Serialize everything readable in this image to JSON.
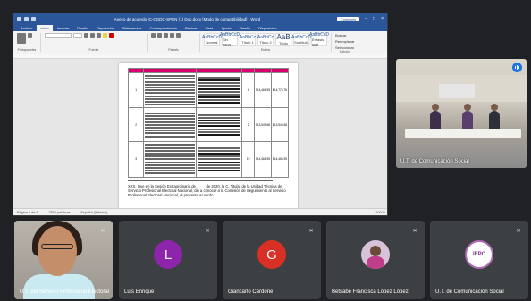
{
  "word": {
    "title": "Anexo de acuerdo IC-CGDC-SPEN (1) Doc.docx [Modo de compatibilidad] - Word",
    "share_label": "Compartir",
    "tabs": [
      "Archivo",
      "Inicio",
      "Insertar",
      "Diseño",
      "Disposición",
      "Referencias",
      "Correspondencia",
      "Revisar",
      "Vista",
      "Ayuda",
      "Diseño",
      "Disposición"
    ],
    "active_tab": "Inicio",
    "ribbon_groups": [
      "Portapapeles",
      "Fuente",
      "Párrafo",
      "Estilos",
      "Edición"
    ],
    "styles": [
      {
        "sample": "AaBbCcD",
        "name": "Normal"
      },
      {
        "sample": "AaBbCcD",
        "name": "Sin espa..."
      },
      {
        "sample": "AaBbCc",
        "name": "Título 1"
      },
      {
        "sample": "AaBbCc",
        "name": "Título 2"
      },
      {
        "sample": "AaB",
        "name": "Título"
      },
      {
        "sample": "AaBbCcD",
        "name": "Subtítulo"
      },
      {
        "sample": "AaBbCcD",
        "name": "Énfasis sutil"
      }
    ],
    "edit_items": [
      "Buscar",
      "Reemplazar",
      "Seleccionar"
    ],
    "table_rows": [
      {
        "num": "1",
        "qty": "4",
        "a": "$14,468.95",
        "b": "$14,773.76"
      },
      {
        "num": "2",
        "qty": "2",
        "a": "$13,549.68",
        "b": "$13,549.68"
      },
      {
        "num": "3",
        "qty": "19",
        "a": "$14,468.95",
        "b": "$14,468.95"
      }
    ],
    "paragraph": "XXX. Que en la Sesión Extraordinaria de ____ de 2020, la C. Titular de la Unidad Técnica del Servicio Profesional Electoral Nacional, dio a conocer a la Comisión de Seguimiento al Servicio Profesional Electoral Nacional, el presente Acuerdo.",
    "status": {
      "page": "Página 6 de 9",
      "words": "2364 palabras",
      "lang": "Español (México)",
      "zoom": "100 %"
    }
  },
  "pinned": {
    "name": "U.T. de Comunicación Social"
  },
  "participants": [
    {
      "name": "U.T. del Servicio Profesional Electoral",
      "kind": "camera"
    },
    {
      "name": "Luis Enrique",
      "kind": "initial",
      "initial": "L",
      "color": "#8e24aa"
    },
    {
      "name": "Giancarlo Cardone",
      "kind": "initial",
      "initial": "G",
      "color": "#d93025"
    },
    {
      "name": "Betsabé Francisca López López",
      "kind": "photo"
    },
    {
      "name": "U.T. de Comunicación Social",
      "kind": "logo",
      "logo_text": "IEPC"
    }
  ]
}
